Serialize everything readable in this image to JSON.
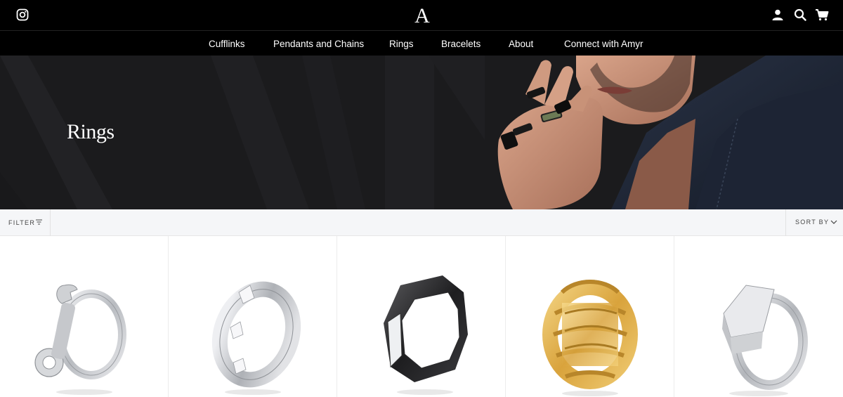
{
  "header": {
    "logo_letter": "A",
    "icons": [
      "instagram-icon",
      "account-icon",
      "search-icon",
      "cart-icon"
    ]
  },
  "nav": {
    "items": [
      {
        "label": "Cufflinks"
      },
      {
        "label": "Pendants and Chains"
      },
      {
        "label": "Rings"
      },
      {
        "label": "Bracelets"
      },
      {
        "label": "About"
      },
      {
        "label": "Connect with Amyr"
      }
    ]
  },
  "hero": {
    "title": "Rings"
  },
  "toolbar": {
    "filter_label": "FILTER",
    "sort_label": "SORT BY"
  },
  "products": [
    {
      "name": "wrench ring",
      "color": "#c9cbce"
    },
    {
      "name": "geometric band",
      "color": "#d3d5d8"
    },
    {
      "name": "black octagon ring",
      "color": "#2b2b2d"
    },
    {
      "name": "gold skeleton hand ring",
      "color": "#e0b44e"
    },
    {
      "name": "silver signet ring",
      "color": "#d6d8db"
    }
  ],
  "colors": {
    "header_bg": "#000000",
    "hero_bg": "#1b1b1d",
    "toolbar_bg": "#f5f6f8"
  }
}
